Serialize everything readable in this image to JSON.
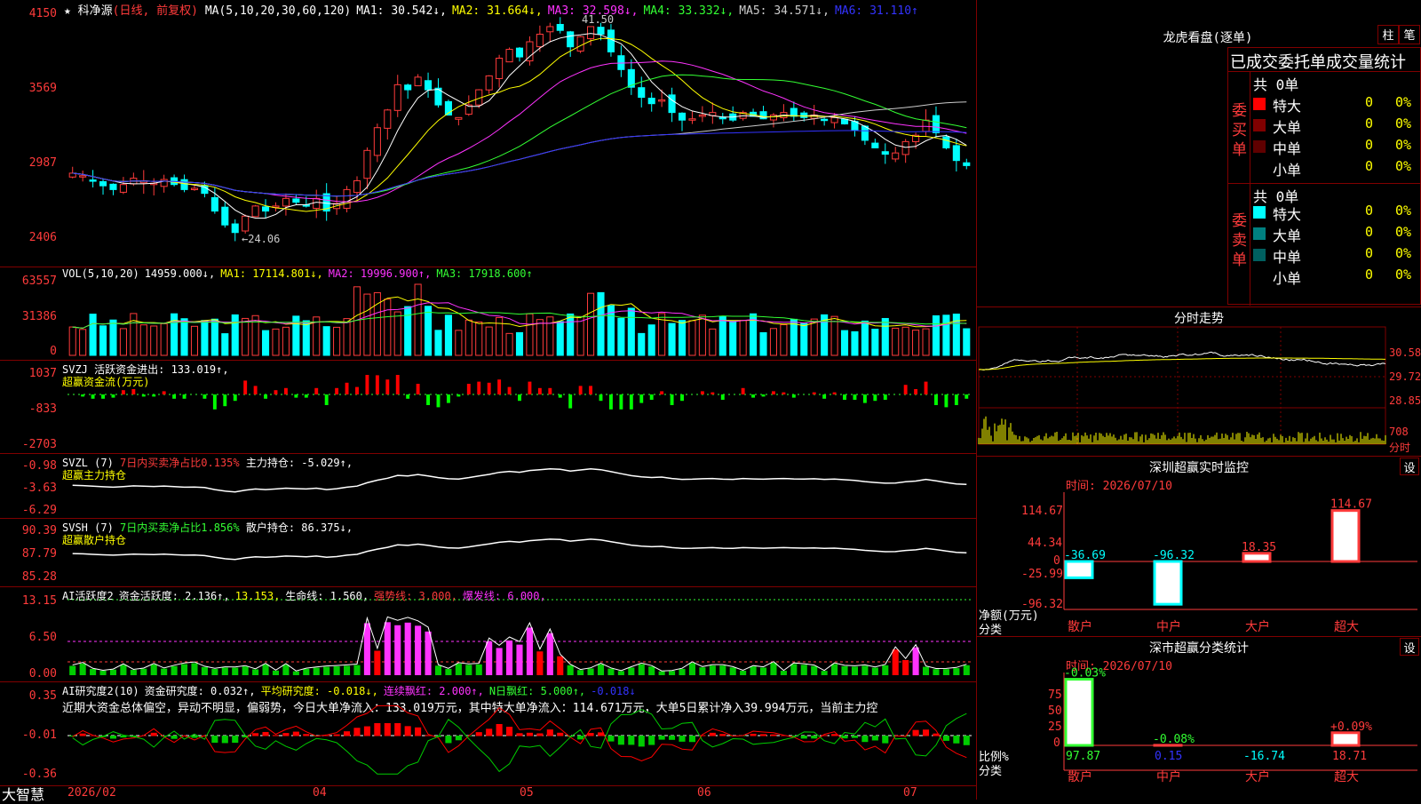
{
  "stock": {
    "star": "★",
    "name": "科净源",
    "mode": "(日线, 前复权)"
  },
  "ma_line": [
    {
      "text": "MA(5,10,20,30,60,120)",
      "color": "#ffffff"
    },
    {
      "text": "MA1: 30.542↓,",
      "color": "#ffffff"
    },
    {
      "text": "MA2: 31.664↓,",
      "color": "#ffff00"
    },
    {
      "text": "MA3: 32.598↓,",
      "color": "#ff33ff"
    },
    {
      "text": "MA4: 33.332↓,",
      "color": "#33ff33"
    },
    {
      "text": "MA5: 34.571↓,",
      "color": "#cccccc"
    },
    {
      "text": "MA6: 31.110↑",
      "color": "#3333ff"
    }
  ],
  "price_axis": [
    "4150",
    "3569",
    "2987",
    "2406"
  ],
  "annotations": {
    "high": "41.50",
    "low": "←24.06"
  },
  "vol": {
    "axis": [
      "63557",
      "31386",
      "0"
    ],
    "line": [
      {
        "text": "VOL(5,10,20)",
        "color": "#ffffff"
      },
      {
        "text": "14959.000↓,",
        "color": "#ffffff"
      },
      {
        "text": "MA1: 17114.801↓,",
        "color": "#ffff00"
      },
      {
        "text": "MA2: 19996.900↑,",
        "color": "#ff33ff"
      },
      {
        "text": "MA3: 17918.600↑",
        "color": "#33ff33"
      }
    ]
  },
  "svzj": {
    "axis": [
      "1037",
      "-833",
      "-2703"
    ],
    "line1": "SVZJ  活跃资金进出: 133.019↑,",
    "line2": "超赢资金流(万元)"
  },
  "svzl": {
    "axis": [
      "-0.98",
      "-3.63",
      "-6.29"
    ],
    "line1a": "SVZL (7)",
    "line1b": "7日内买卖净占比0.135%",
    "line1c": "主力持仓: -5.029↑,",
    "line2": "超赢主力持仓"
  },
  "svsh": {
    "axis": [
      "90.39",
      "87.79",
      "85.28"
    ],
    "line1a": "SVSH (7)",
    "line1b": "7日内买卖净占比1.856%",
    "line1c": "散户持仓: 86.375↓,",
    "line2": "超赢散户持仓"
  },
  "ai1": {
    "axis": [
      "13.15",
      "6.50",
      "0.00"
    ],
    "line": [
      {
        "text": "AI活跃度2",
        "color": "#ffffff"
      },
      {
        "text": "资金活跃度: 2.136↑,",
        "color": "#ffffff"
      },
      {
        "text": "13.153,",
        "color": "#ffff00"
      },
      {
        "text": "生命线: 1.560,",
        "color": "#ffffff"
      },
      {
        "text": "强势线: 3.000,",
        "color": "#ff3b3b"
      },
      {
        "text": "爆发线: 6.000,",
        "color": "#ff33ff"
      }
    ]
  },
  "ai2": {
    "axis": [
      "0.35",
      "-0.01",
      "-0.36"
    ],
    "line": [
      {
        "text": "AI研究度2(10)",
        "color": "#ffffff"
      },
      {
        "text": "资金研究度: 0.032↑,",
        "color": "#ffffff"
      },
      {
        "text": "平均研究度: -0.018↓,",
        "color": "#ffff00"
      },
      {
        "text": "连续飘红: 2.000↑,",
        "color": "#ff33ff"
      },
      {
        "text": "N日飘红: 5.000↑,",
        "color": "#33ff33"
      },
      {
        "text": "-0.018↓",
        "color": "#3333ff"
      }
    ],
    "summary": "近期大资金总体偏空，异动不明显，偏弱势，今日大单净流入：133.019万元，其中特大单净流入：114.671万元，大单5日累计净入39.994万元，当前主力控"
  },
  "xaxis": [
    "2026/02",
    "04",
    "05",
    "06",
    "07"
  ],
  "bottom_left": "大智慧",
  "right": {
    "lhb_title": "龙虎看盘(逐单)",
    "btn_zhu": "柱",
    "btn_bi": "笔",
    "stats_header": "已成交委托单成交量统计",
    "buy": {
      "label": "委买单",
      "total": "共 0单",
      "rows": [
        {
          "name": "特大",
          "val": "0",
          "pct": "0%",
          "color": "#ff0000"
        },
        {
          "name": "大单",
          "val": "0",
          "pct": "0%",
          "color": "#800000"
        },
        {
          "name": "中单",
          "val": "0",
          "pct": "0%",
          "color": "#600000"
        },
        {
          "name": "小单",
          "val": "0",
          "pct": "0%",
          "color": ""
        }
      ]
    },
    "sell": {
      "label": "委卖单",
      "total": "共 0单",
      "rows": [
        {
          "name": "特大",
          "val": "0",
          "pct": "0%",
          "color": "#00ffff"
        },
        {
          "name": "大单",
          "val": "0",
          "pct": "0%",
          "color": "#008080"
        },
        {
          "name": "中单",
          "val": "0",
          "pct": "0%",
          "color": "#006060"
        },
        {
          "name": "小单",
          "val": "0",
          "pct": "0%",
          "color": ""
        }
      ]
    },
    "fenshi_title": "分时走势",
    "fenshi_axis": [
      "30.58",
      "29.72",
      "28.85",
      "708",
      "分时"
    ],
    "sz_title": "深圳超赢实时监控",
    "sz_btn": "设",
    "sz_time": "时间: 2026/07/10",
    "sz_axis": [
      "114.67",
      "44.34",
      "0",
      "-25.99",
      "-96.32"
    ],
    "sz_ylabel1": "净额(万元)",
    "sz_ylabel2": "分类",
    "sz_cats": [
      "散户",
      "中户",
      "大户",
      "超大"
    ],
    "sz_vals": [
      "-36.69",
      "-96.32",
      "18.35",
      "114.67"
    ],
    "fl_title": "深市超赢分类统计",
    "fl_btn": "设",
    "fl_time": "时间: 2026/07/10",
    "fl_axis": [
      "75",
      "50",
      "25",
      "0"
    ],
    "fl_ylabel1": "比例%",
    "fl_ylabel2": "分类",
    "fl_cats": [
      "散户",
      "中户",
      "大户",
      "超大"
    ],
    "fl_top": [
      "-0.03%",
      "-0.08%",
      "",
      "+0.09%"
    ],
    "fl_bottom": [
      "97.87",
      "0.15",
      "-16.74",
      "18.71"
    ]
  },
  "chart_data": {
    "type": "candlestick",
    "title": "科净源",
    "ylim": [
      2406,
      4150
    ],
    "xaxis_ticks": [
      "2026/02",
      "04",
      "05",
      "06",
      "07"
    ],
    "high": "41.50",
    "low": "24.06",
    "close_series": [
      29.2,
      29.0,
      28.6,
      28.2,
      27.9,
      28.3,
      28.8,
      28.6,
      28.4,
      28.7,
      28.3,
      27.9,
      28.0,
      27.6,
      26.2,
      25.1,
      24.5,
      25.8,
      26.6,
      26.2,
      26.6,
      27.2,
      26.9,
      26.6,
      27.2,
      26.2,
      26.8,
      27.9,
      28.6,
      31.0,
      32.8,
      34.2,
      36.2,
      35.8,
      36.8,
      35.8,
      34.6,
      33.8,
      33.6,
      34.6,
      35.8,
      36.9,
      38.3,
      39.0,
      38.4,
      39.6,
      40.2,
      40.8,
      40.5,
      39.2,
      40.0,
      40.8,
      40.2,
      38.8,
      37.4,
      36.0,
      35.2,
      34.7,
      35.0,
      34.0,
      33.4,
      33.5,
      33.8,
      34.0,
      33.5,
      33.4,
      34.0,
      33.7,
      33.5,
      33.8,
      34.0,
      33.7,
      33.6,
      33.8,
      33.4,
      33.6,
      33.1,
      32.6,
      31.8,
      31.2,
      30.7,
      30.8,
      31.7,
      32.2,
      33.4,
      32.4,
      31.2,
      30.2,
      29.8
    ]
  }
}
